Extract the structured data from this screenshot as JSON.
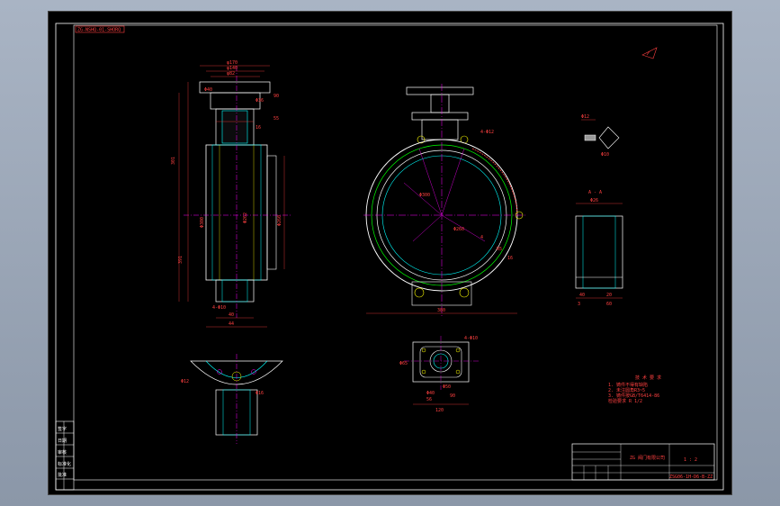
{
  "drawing": {
    "header_tag": "ZG-NSHQ-01-SHORQ",
    "section_label": "A - A",
    "title_block": {
      "company": "ZG 阀门有限公司",
      "drawing_number": "ZSG06-1H-D6-B-ZZ",
      "scale": "1 : 2"
    },
    "notes": [
      "技 术 要 求",
      "1. 铸件不得有缺陷",
      "2. 未注圆角R3~5",
      "3. 铸件按GB/T6414-86",
      "   检验要求 R 1/2"
    ],
    "dimensions": {
      "side_view": [
        "φ170",
        "φ140",
        "φ82",
        "Φ40",
        "Φ36",
        "90",
        "55",
        "16",
        "301",
        "391",
        "Φ300",
        "Φ262",
        "Φ260",
        "40",
        "44",
        "4-Φ10"
      ],
      "front_view": [
        "4-Φ12",
        "Φ300",
        "Φ260",
        "R5",
        "4",
        "380",
        "16"
      ],
      "flange_view": [
        "4-Φ10",
        "Φ65",
        "Φ50",
        "Φ40",
        "90",
        "56",
        "120"
      ],
      "section_view": [
        "Φ26",
        "40",
        "20",
        "3",
        "60"
      ],
      "detail_view": [
        "Φ12",
        "Φ10"
      ],
      "bottom_view": [
        "Φ12",
        "Φ16"
      ]
    },
    "sidebar_labels": [
      "签字",
      "日期",
      "审核",
      "标准化",
      "批准"
    ]
  }
}
